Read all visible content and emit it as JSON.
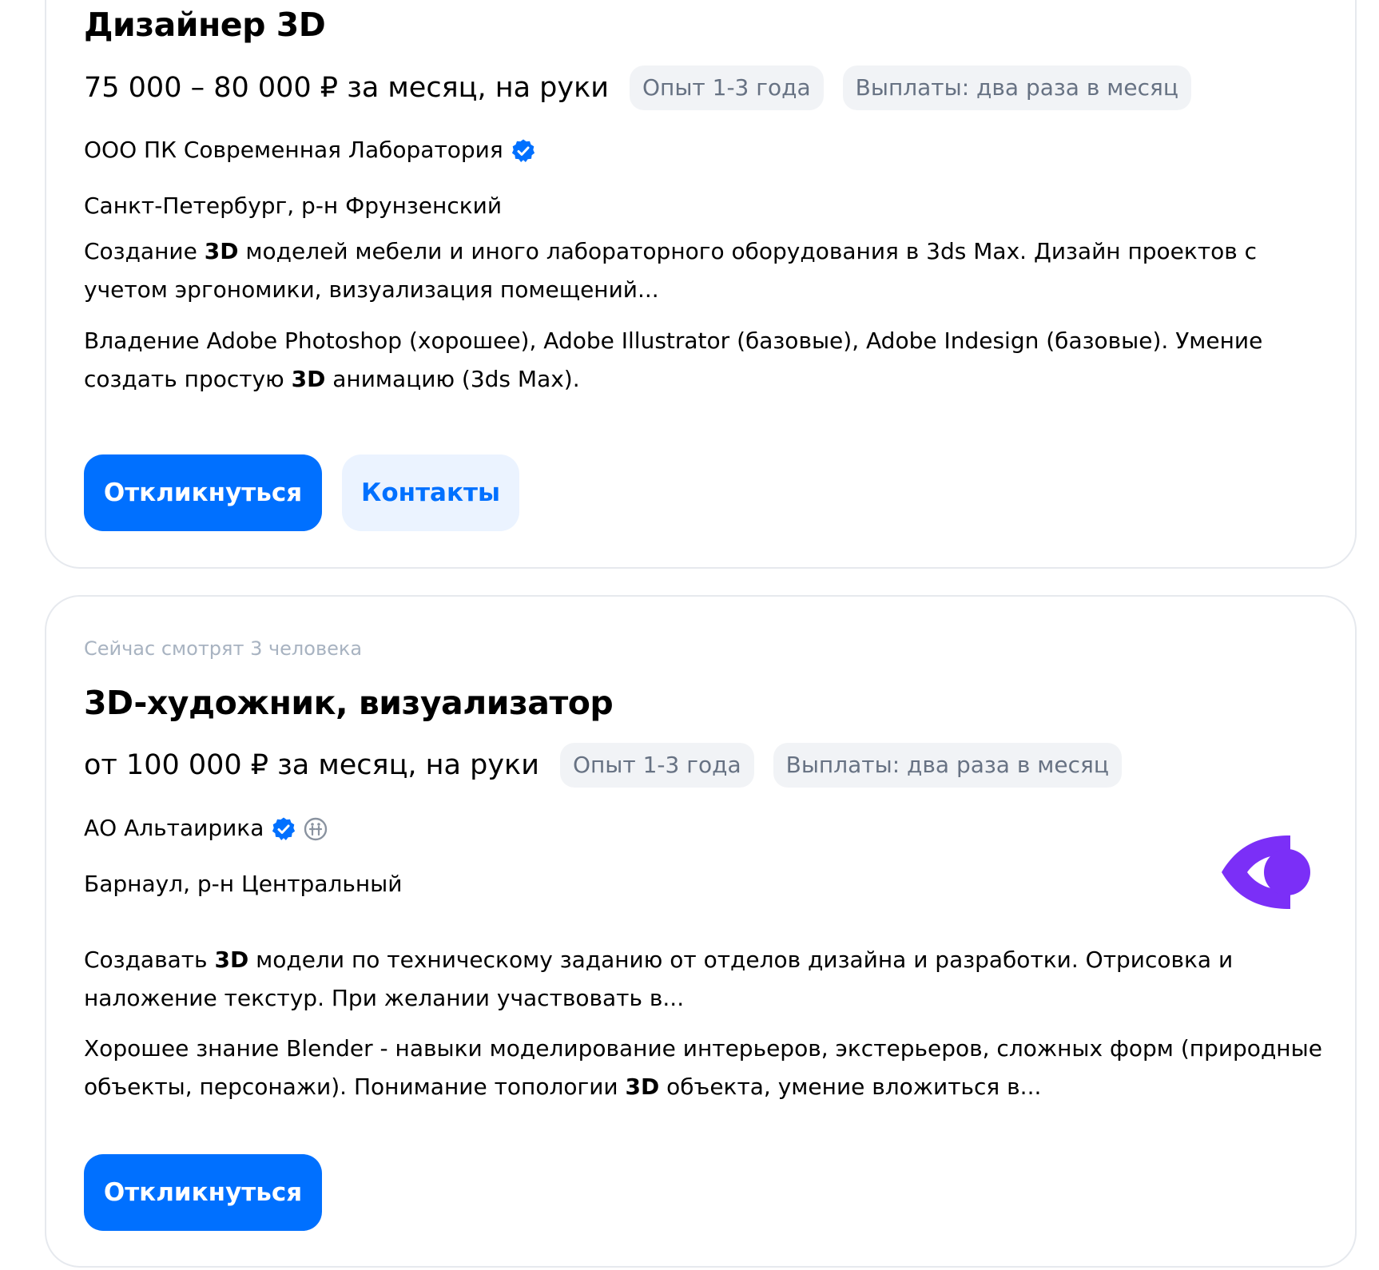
{
  "vacancies": [
    {
      "title": "Дизайнер 3D",
      "salary": "75 000 – 80 000 ₽ за месяц, на руки",
      "tags": [
        "Опыт 1-3 года",
        "Выплаты: два раза в месяц"
      ],
      "company": "ООО ПК Современная Лаборатория",
      "location": "Санкт-Петербург, р-н Фрунзенский",
      "description": {
        "pre": "Создание ",
        "bold": "3D",
        "post": " моделей мебели и иного лабораторного оборудования в 3ds Max. Дизайн проектов с учетом эргономики, визуализация помещений..."
      },
      "requirements": {
        "pre": "Владение Adobe Photoshop (хорошее), Adobe Illustrator (базовые), Adobe Indesign (базовые). Умение создать простую ",
        "bold": "3D",
        "post": " анимацию (3ds Max)."
      },
      "apply_label": "Откликнуться",
      "contacts_label": "Контакты"
    },
    {
      "viewers": "Сейчас смотрят 3 человека",
      "title": "3D-художник, визуализатор",
      "salary": "от 100 000 ₽ за месяц, на руки",
      "tags": [
        "Опыт 1-3 года",
        "Выплаты: два раза в месяц"
      ],
      "company": "АО Альтаирика",
      "location": "Барнаул, р-н Центральный",
      "description": {
        "pre": "Создавать ",
        "bold": "3D",
        "post": " модели по техническому заданию от отделов дизайна и разработки. Отрисовка и наложение текстур. При желании участвовать в..."
      },
      "requirements": {
        "pre": "Хорошее знание Blender - навыки моделирование интерьеров, экстерьеров, сложных форм (природные объекты, персонажи). Понимание топологии ",
        "bold": "3D",
        "post": " объекта, умение вложиться в..."
      },
      "apply_label": "Откликнуться"
    }
  ],
  "icons": {
    "verified": "verified-badge-icon",
    "accessibility": "accessibility-icon",
    "logo": "company-logo-eye"
  },
  "colors": {
    "primary": "#0070ff",
    "chip_bg": "#f1f3f6",
    "chip_text": "#677283",
    "logo": "#7b2ff7"
  }
}
